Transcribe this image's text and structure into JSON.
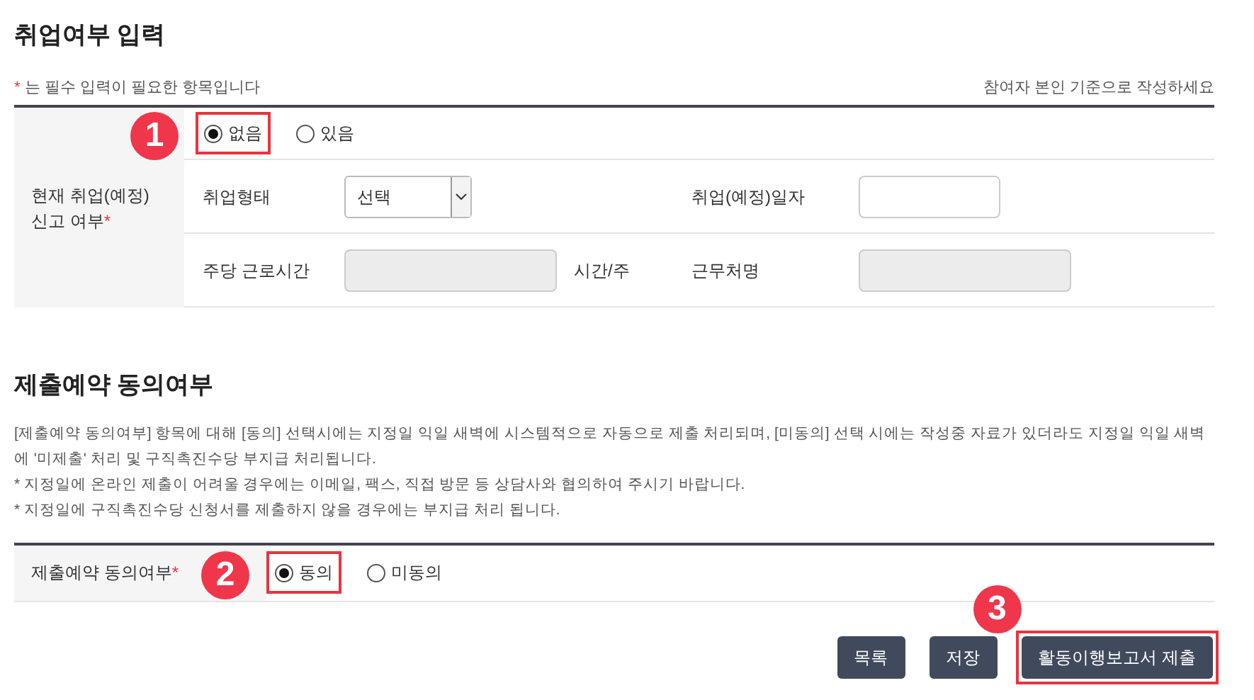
{
  "section1": {
    "title": "취업여부 입력",
    "required_note": {
      "mark": "*",
      "text": "는 필수 입력이 필요한 항목입니다"
    },
    "hint": "참여자 본인 기준으로 작성하세요",
    "row_label": "현재 취업(예정) 신고 여부",
    "required_mark": "*",
    "radios": [
      {
        "label": "없음",
        "selected": true,
        "highlighted": true,
        "marker": "1"
      },
      {
        "label": "있음",
        "selected": false,
        "highlighted": false
      }
    ],
    "fields": [
      [
        {
          "kind": "label",
          "text": "취업형태"
        },
        {
          "kind": "select",
          "value": "선택"
        },
        {
          "kind": "label",
          "text": "취업(예정)일자"
        },
        {
          "kind": "input",
          "disabled": false
        }
      ],
      [
        {
          "kind": "label",
          "text": "주당 근로시간"
        },
        {
          "kind": "input",
          "disabled": true,
          "suffix": "시간/주"
        },
        {
          "kind": "label",
          "text": "근무처명"
        },
        {
          "kind": "input",
          "disabled": true
        }
      ]
    ]
  },
  "section2": {
    "title": "제출예약 동의여부",
    "notice": "[제출예약 동의여부] 항목에 대해 [동의] 선택시에는 지정일 익일 새벽에 시스템적으로 자동으로 제출 처리되며, [미동의] 선택 시에는 작성중 자료가 있더라도 지정일 익일 새벽에 '미제출' 처리 및 구직촉진수당 부지급 처리됩니다.",
    "bullets": [
      {
        "mark": "*",
        "text": "지정일에 온라인 제출이 어려울 경우에는 이메일, 팩스, 직접 방문 등 상담사와 협의하여 주시기 바랍니다."
      },
      {
        "mark": "*",
        "text": "지정일에 구직촉진수당 신청서를 제출하지 않을 경우에는 부지급 처리 됩니다."
      }
    ],
    "row_label": "제출예약 동의여부",
    "required_mark": "*",
    "radios": [
      {
        "label": "동의",
        "selected": true,
        "highlighted": true,
        "marker": "2"
      },
      {
        "label": "미동의",
        "selected": false,
        "highlighted": false
      }
    ]
  },
  "buttons": [
    {
      "label": "목록",
      "highlighted": false
    },
    {
      "label": "저장",
      "highlighted": false
    },
    {
      "label": "활동이행보고서 제출",
      "highlighted": true,
      "marker": "3"
    }
  ]
}
